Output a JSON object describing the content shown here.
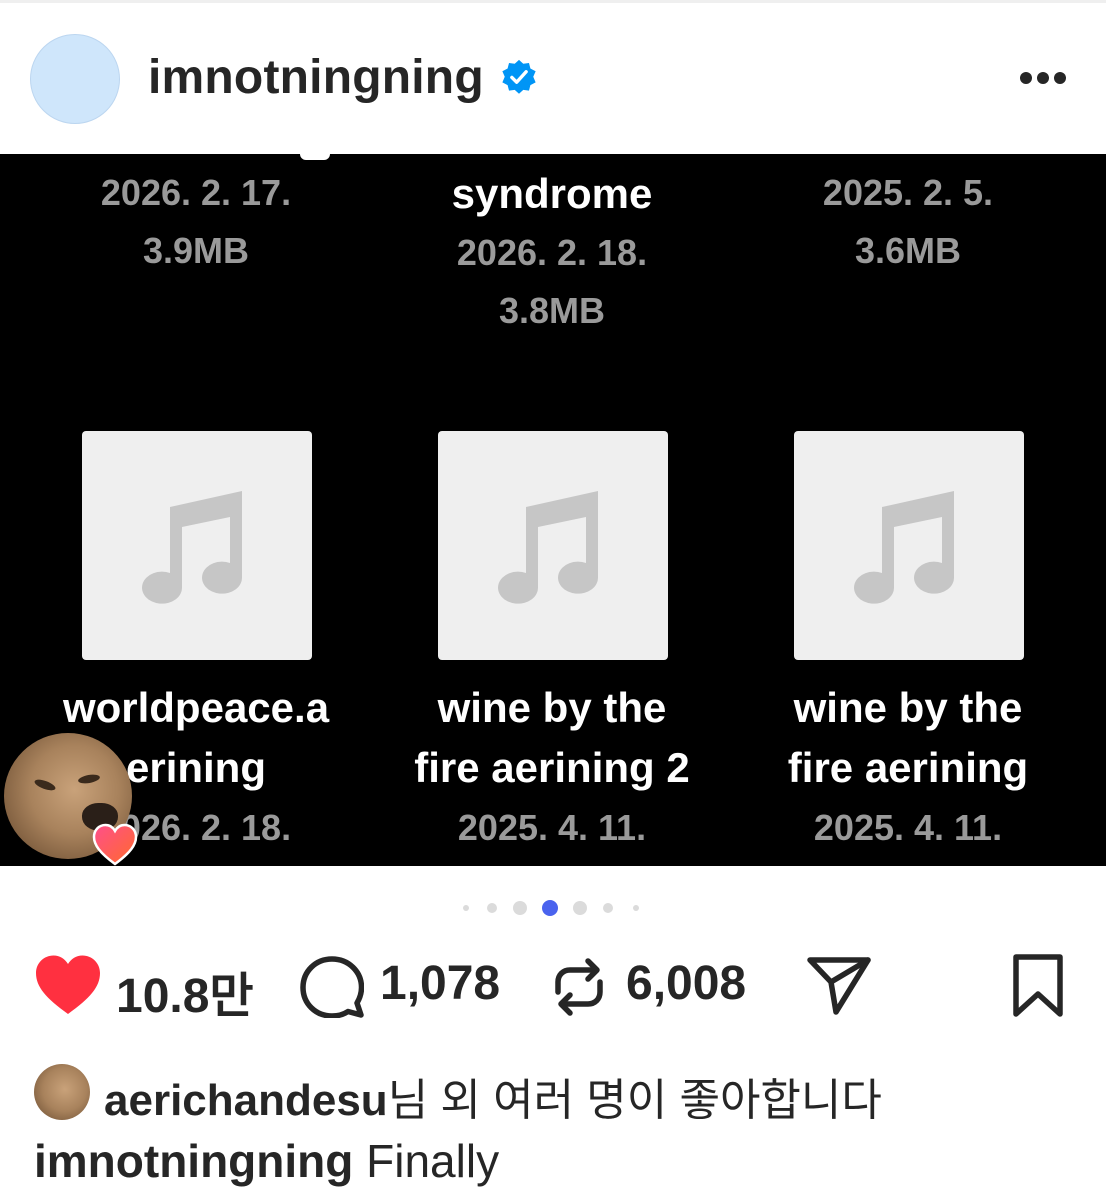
{
  "post": {
    "username": "imnotningning",
    "verified_color": "#0095f6"
  },
  "media": {
    "top_row": [
      {
        "name": "",
        "lines": [
          "2026. 2. 17.",
          "3.9MB"
        ]
      },
      {
        "name": "syndrome",
        "lines": [
          "2026. 2. 18.",
          "3.8MB"
        ]
      },
      {
        "name": "",
        "lines": [
          "2025. 2. 5.",
          "3.6MB"
        ]
      }
    ],
    "bottom_row": [
      {
        "name_line1": "worldpeace.a",
        "name_line2": "erining",
        "date": "2026. 2. 18."
      },
      {
        "name_line1": "wine by the",
        "name_line2": "fire aerining 2",
        "date": "2025. 4. 11."
      },
      {
        "name_line1": "wine by the",
        "name_line2": "fire aerining",
        "date": "2025. 4. 11."
      }
    ],
    "icon": "music-note-icon"
  },
  "pagination": {
    "total": 7,
    "active_index": 3,
    "active_color": "#4a63ee"
  },
  "actions": {
    "likes": "10.8만",
    "comments": "1,078",
    "reposts": "6,008",
    "like_color": "#ff3040"
  },
  "liked_by": {
    "user": "aerichandesu",
    "suffix": "님 외 여러 명이 좋아합니다"
  },
  "caption": {
    "user": "imnotningning",
    "text": "Finally"
  }
}
